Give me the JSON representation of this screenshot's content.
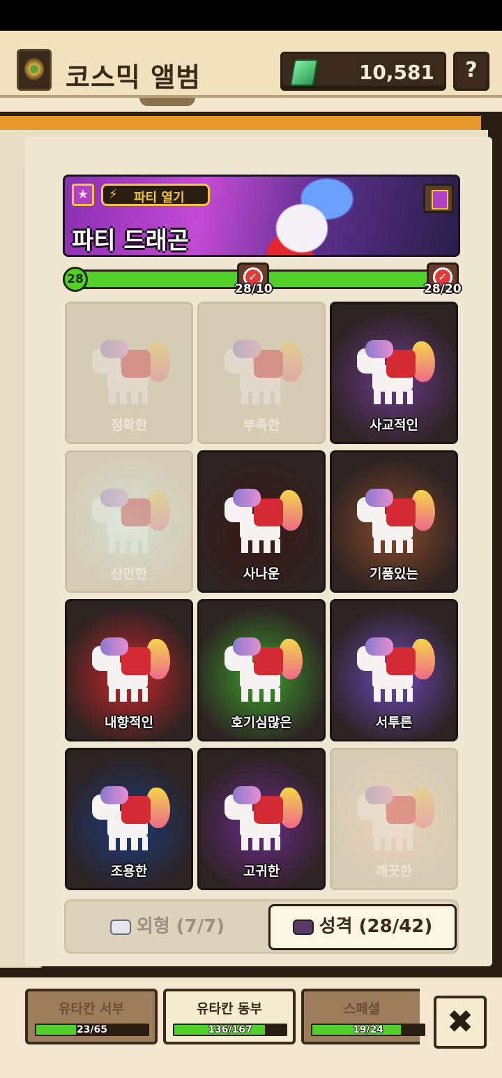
{
  "header": {
    "title": "코스믹 앨범",
    "currency_value": "10,581",
    "help_label": "?"
  },
  "banner": {
    "tag_label": "파티 열기",
    "title": "파티 드래곤",
    "star_icon": "★",
    "bolt_icon": "⚡"
  },
  "progress": {
    "current": "28",
    "current_value": 28,
    "max_value": 20,
    "milestones": [
      {
        "label": "28/10"
      },
      {
        "label": "28/20"
      }
    ]
  },
  "cards": [
    {
      "label": "정확한",
      "locked": true,
      "glow": "#d6ccb6"
    },
    {
      "label": "부족한",
      "locked": true,
      "glow": "#d6ccb6"
    },
    {
      "label": "사교적인",
      "locked": false,
      "glow": "#6a3a8a"
    },
    {
      "label": "산만한",
      "locked": true,
      "glow": "#cfe0cf"
    },
    {
      "label": "사나운",
      "locked": false,
      "glow": "#3a1a14"
    },
    {
      "label": "기품있는",
      "locked": false,
      "glow": "#8a4a2a"
    },
    {
      "label": "내향적인",
      "locked": false,
      "glow": "#c8262a"
    },
    {
      "label": "호기심많은",
      "locked": false,
      "glow": "#3aa02a"
    },
    {
      "label": "서투른",
      "locked": false,
      "glow": "#6a48b8"
    },
    {
      "label": "조용한",
      "locked": false,
      "glow": "#1a3a7a"
    },
    {
      "label": "고귀한",
      "locked": false,
      "glow": "#6a2a8a"
    },
    {
      "label": "깨끗한",
      "locked": true,
      "glow": "#e8d2b8"
    }
  ],
  "toggle": {
    "appearance_label": "외형 (7/7)",
    "personality_label": "성격 (28/42)"
  },
  "regions": [
    {
      "name": "유타칸 서부",
      "count": "23/65",
      "fill": 0.354,
      "active": false
    },
    {
      "name": "유타칸 동부",
      "count": "136/167",
      "fill": 0.814,
      "active": true
    },
    {
      "name": "스페셜",
      "count": "19/24",
      "fill": 0.792,
      "active": false
    }
  ],
  "close_icon": "✖",
  "colors": {
    "accent_green": "#52d12a",
    "banner_purple": "#b23fc8",
    "gold": "#f0c63a"
  }
}
